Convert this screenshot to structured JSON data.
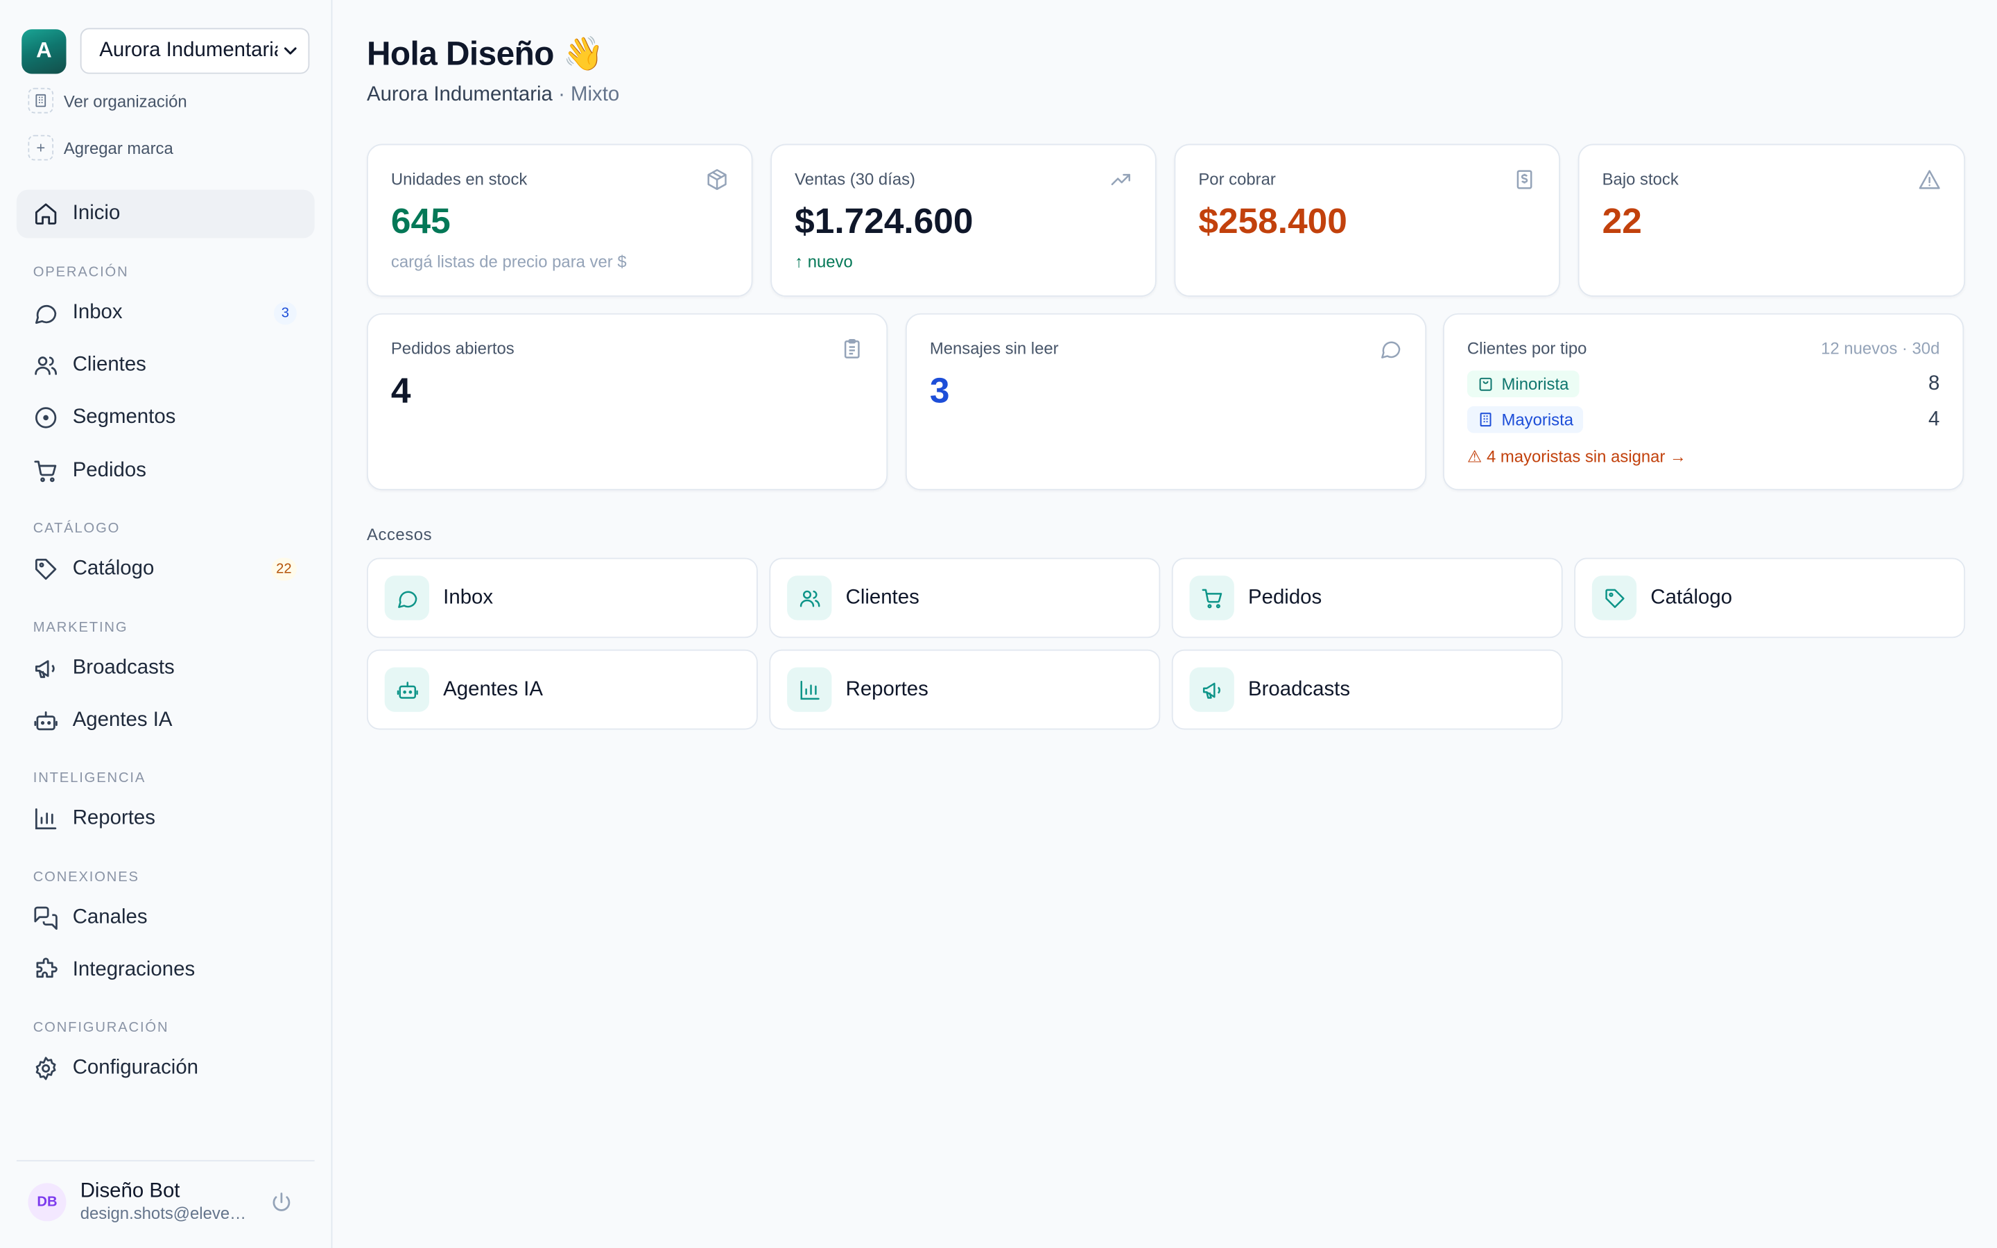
{
  "org": {
    "avatar_letter": "A",
    "selected": "Aurora Indumentaria",
    "view_org": "Ver organización",
    "add_brand": "Agregar marca"
  },
  "nav": {
    "home": "Inicio",
    "sections": {
      "operacion": "OPERACIÓN",
      "catalogo": "CATÁLOGO",
      "marketing": "MARKETING",
      "inteligencia": "INTELIGENCIA",
      "conexiones": "CONEXIONES",
      "configuracion": "CONFIGURACIÓN"
    },
    "inbox": "Inbox",
    "inbox_badge": "3",
    "clientes": "Clientes",
    "segmentos": "Segmentos",
    "pedidos": "Pedidos",
    "catalogo": "Catálogo",
    "catalogo_badge": "22",
    "broadcasts": "Broadcasts",
    "agentes": "Agentes IA",
    "reportes": "Reportes",
    "canales": "Canales",
    "integraciones": "Integraciones",
    "configuracion": "Configuración"
  },
  "user": {
    "initials": "DB",
    "name": "Diseño Bot",
    "email": "design.shots@eleven.local"
  },
  "header": {
    "greeting": "Hola Diseño 👋",
    "org_name": "Aurora Indumentaria",
    "org_type": "· Mixto"
  },
  "stats": {
    "stock": {
      "label": "Unidades en stock",
      "value": "645",
      "hint": "cargá listas de precio para ver $"
    },
    "ventas": {
      "label": "Ventas (30 días)",
      "value": "$1.724.600",
      "trend": "↑ nuevo"
    },
    "cobrar": {
      "label": "Por cobrar",
      "value": "$258.400"
    },
    "bajo": {
      "label": "Bajo stock",
      "value": "22"
    },
    "pedidos": {
      "label": "Pedidos abiertos",
      "value": "4"
    },
    "mensajes": {
      "label": "Mensajes sin leer",
      "value": "3"
    },
    "clientes_tipo": {
      "label": "Clientes por tipo",
      "new_note": "12 nuevos · 30d",
      "minorista": "Minorista",
      "minorista_count": "8",
      "mayorista": "Mayorista",
      "mayorista_count": "4",
      "warning": "⚠ 4 mayoristas sin asignar →"
    }
  },
  "accesos": {
    "title": "Accesos",
    "inbox": "Inbox",
    "clientes": "Clientes",
    "pedidos": "Pedidos",
    "catalogo": "Catálogo",
    "agentes": "Agentes IA",
    "reportes": "Reportes",
    "broadcasts": "Broadcasts"
  },
  "colors": {
    "stock_value": "#047857",
    "ventas_value": "#0f172a",
    "cobrar_value": "#c2410c",
    "bajo_value": "#c2410c",
    "mensajes_value": "#1d4ed8",
    "accent": "#0d9488"
  }
}
